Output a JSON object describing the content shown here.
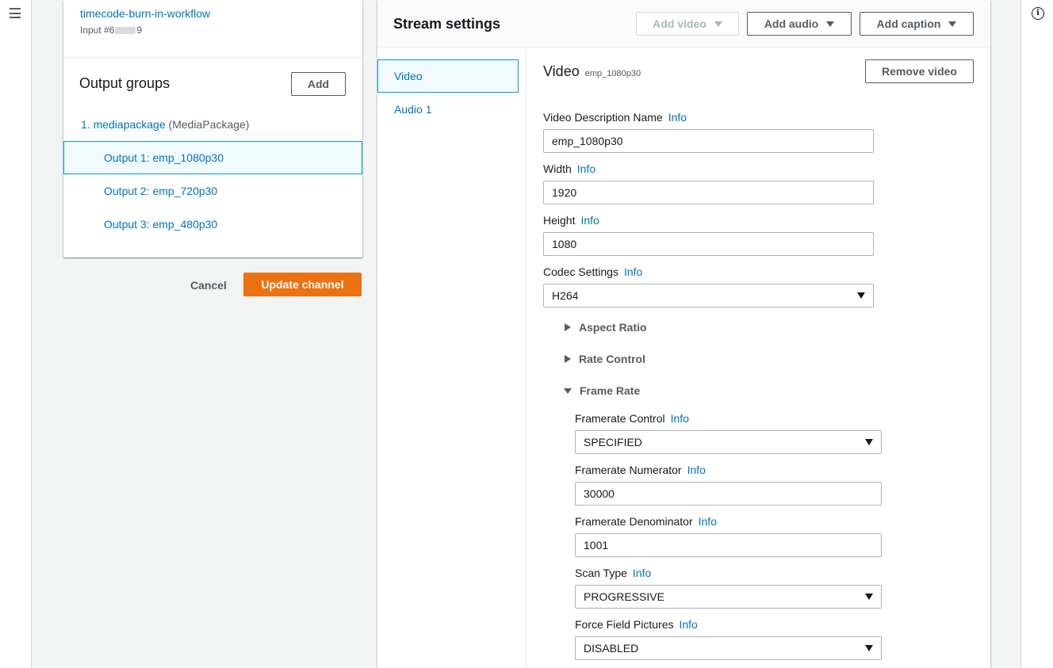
{
  "left_panel": {
    "input_link": "timecode-burn-in-workflow",
    "input_id_prefix": "Input #6",
    "input_id_suffix": "9",
    "output_groups_title": "Output groups",
    "add_label": "Add",
    "group_item": "1. mediapackage",
    "group_type": "(MediaPackage)",
    "outputs": [
      "Output 1: emp_1080p30",
      "Output 2: emp_720p30",
      "Output 3: emp_480p30"
    ],
    "selected_output": 0,
    "cancel_label": "Cancel",
    "update_label": "Update channel"
  },
  "stream": {
    "title": "Stream settings",
    "add_video": "Add video",
    "add_audio": "Add audio",
    "add_caption": "Add caption",
    "tabs": [
      "Video",
      "Audio 1"
    ],
    "selected_tab": 0,
    "section_title": "Video",
    "section_sub": "emp_1080p30",
    "remove_label": "Remove video",
    "info_label": "Info",
    "fields": {
      "video_description_name": {
        "label": "Video Description Name",
        "value": "emp_1080p30"
      },
      "width": {
        "label": "Width",
        "value": "1920"
      },
      "height": {
        "label": "Height",
        "value": "1080"
      },
      "codec_settings": {
        "label": "Codec Settings",
        "value": "H264"
      }
    },
    "expanders": {
      "aspect_ratio": "Aspect Ratio",
      "rate_control": "Rate Control",
      "frame_rate": "Frame Rate"
    },
    "frame_rate_fields": {
      "framerate_control": {
        "label": "Framerate Control",
        "value": "SPECIFIED"
      },
      "framerate_numerator": {
        "label": "Framerate Numerator",
        "value": "30000"
      },
      "framerate_denominator": {
        "label": "Framerate Denominator",
        "value": "1001"
      },
      "scan_type": {
        "label": "Scan Type",
        "value": "PROGRESSIVE"
      },
      "force_field_pictures": {
        "label": "Force Field Pictures",
        "value": "DISABLED"
      }
    }
  },
  "colors": {
    "link": "#0073bb",
    "primary": "#ec7211",
    "selected_bg": "#f1faff",
    "selected_border": "#00a1c9"
  },
  "icons": {
    "menu": "hamburger-menu-icon",
    "help": "info-circle-icon"
  }
}
